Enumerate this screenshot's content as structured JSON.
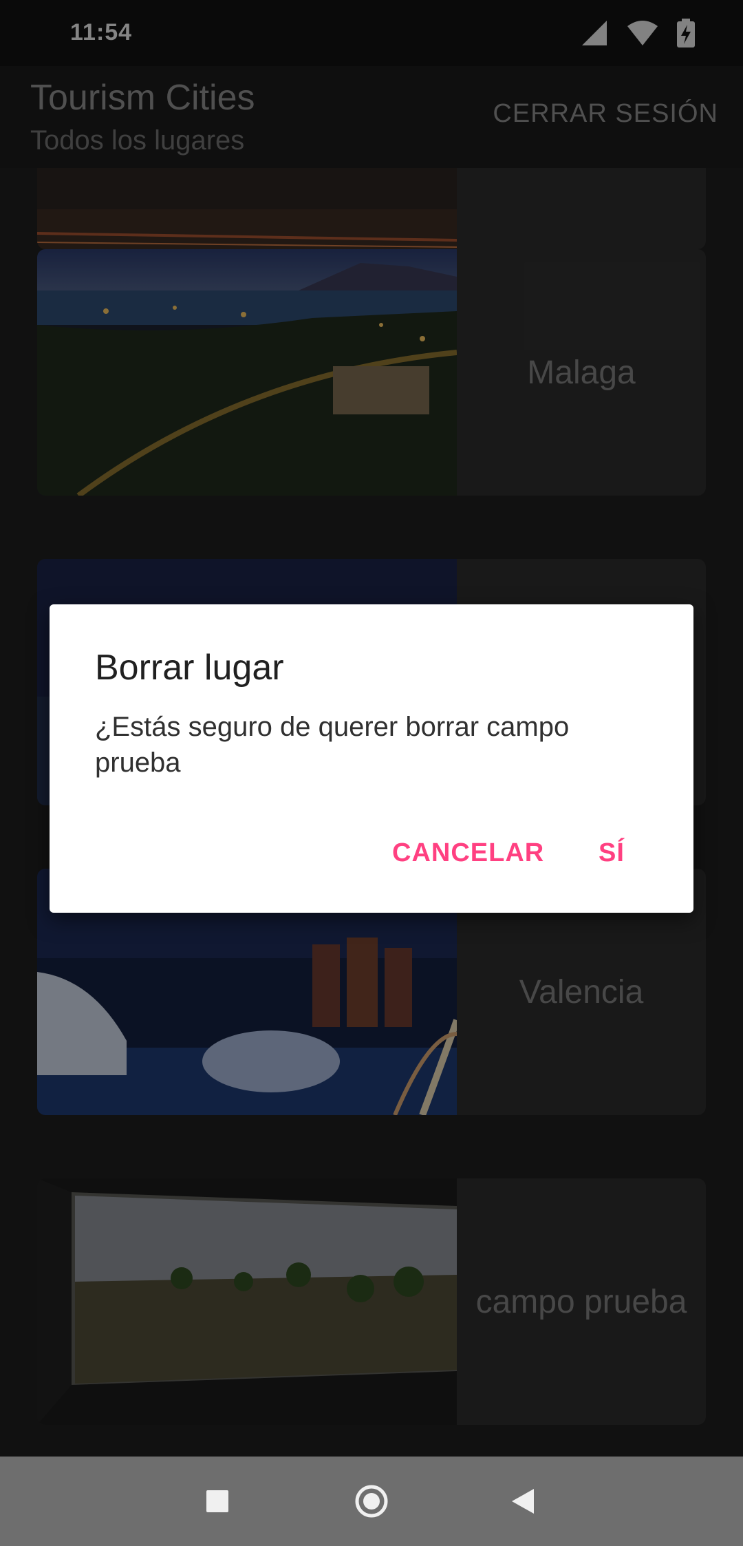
{
  "status_bar": {
    "time": "11:54"
  },
  "app_bar": {
    "title": "Tourism Cities",
    "subtitle": "Todos los lugares",
    "logout_label": "CERRAR SESIÓN"
  },
  "places": [
    {
      "name": ""
    },
    {
      "name": "Malaga"
    },
    {
      "name": ""
    },
    {
      "name": "Valencia"
    },
    {
      "name": "campo prueba"
    }
  ],
  "dialog": {
    "title": "Borrar lugar",
    "message": "¿Estás seguro de querer borrar campo prueba",
    "cancel_label": "CANCELAR",
    "confirm_label": "SÍ",
    "accent_color": "#ff4081"
  },
  "nav_bar": {
    "icons": [
      "recents-icon",
      "home-icon",
      "back-icon"
    ]
  }
}
